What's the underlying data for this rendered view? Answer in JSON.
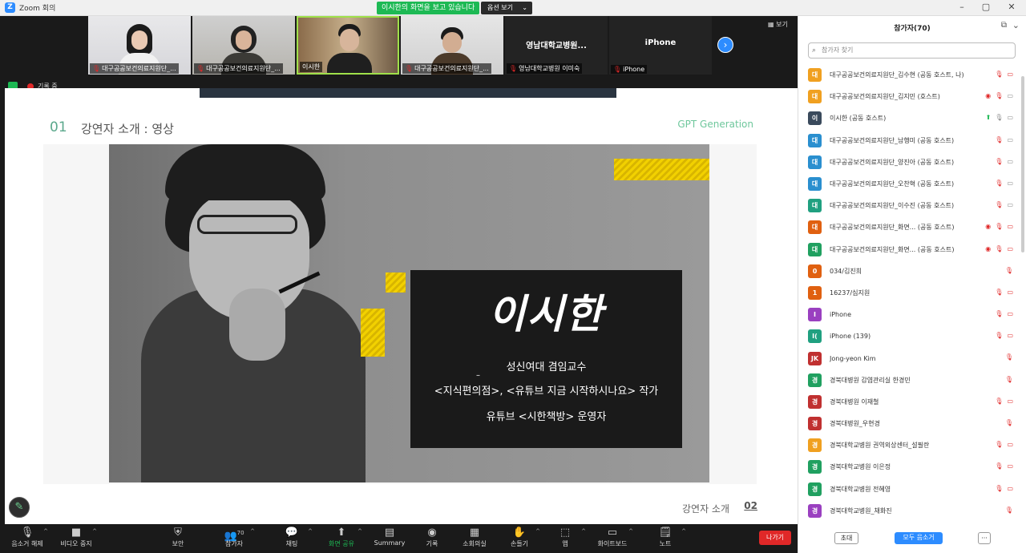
{
  "window": {
    "title": "Zoom 회의",
    "share_banner": "이시한의 화면을 보고 있습니다",
    "view_options": "옵션 보기"
  },
  "strip": {
    "tiles": [
      {
        "label": "대구공공보건의료지원단_..."
      },
      {
        "label": "대구공공보건의료지원단_..."
      },
      {
        "label": "이시한"
      },
      {
        "label": "대구공공보건의료지원단_..."
      },
      {
        "center": "영남대학교병원...",
        "label": "영남대학교병원 이미숙"
      },
      {
        "center": "iPhone",
        "label": "iPhone"
      }
    ],
    "view_label": "보기",
    "recording": "기록 중"
  },
  "slide": {
    "number": "01",
    "heading": "강연자 소개 : 영상",
    "brand": "GPT Generation",
    "speaker_name": "이시한",
    "line1": "성신여대 겸임교수",
    "dash": "–",
    "line2": "<지식편의점>, <유튜브 지금 시작하시나요> 작가",
    "line3": "유튜브 <시한책방> 운영자",
    "footer_text": "강연자 소개",
    "footer_num": "02"
  },
  "toolbar": {
    "items": [
      {
        "label": "음소거 해제",
        "icon": "mic-muted-icon"
      },
      {
        "label": "비디오 중지",
        "icon": "video-icon"
      },
      {
        "label": "보안",
        "icon": "shield-icon"
      },
      {
        "label": "참가자",
        "icon": "participants-icon",
        "count": "70"
      },
      {
        "label": "채팅",
        "icon": "chat-icon"
      },
      {
        "label": "화면 공유",
        "icon": "share-screen-icon"
      },
      {
        "label": "Summary",
        "icon": "summary-icon"
      },
      {
        "label": "기록",
        "icon": "record-icon"
      },
      {
        "label": "소회의실",
        "icon": "breakout-icon"
      },
      {
        "label": "손들기",
        "icon": "raise-hand-icon"
      },
      {
        "label": "앱",
        "icon": "apps-icon"
      },
      {
        "label": "화이트보드",
        "icon": "whiteboard-icon"
      },
      {
        "label": "노트",
        "icon": "notes-icon"
      }
    ],
    "leave": "나가기"
  },
  "panel": {
    "title": "참가자(70)",
    "search_placeholder": "참가자 찾기",
    "participants": [
      {
        "initial": "대",
        "name": "대구공공보건의료지원단_김수현 (공동 호스트, 나)",
        "color": "#f0a020"
      },
      {
        "initial": "대",
        "name": "대구공공보건의료지원단_김지민 (호스트)",
        "color": "#f0a020"
      },
      {
        "initial": "이",
        "name": "이시한 (공동 호스트)",
        "color": "#3a4a5c"
      },
      {
        "initial": "대",
        "name": "대구공공보건의료지원단_남행미 (공동 호스트)",
        "color": "#2a8fcf"
      },
      {
        "initial": "대",
        "name": "대구공공보건의료지원단_양진아 (공동 호스트)",
        "color": "#2a8fcf"
      },
      {
        "initial": "대",
        "name": "대구공공보건의료지원단_오찬혁 (공동 호스트)",
        "color": "#2a8fcf"
      },
      {
        "initial": "대",
        "name": "대구공공보건의료지원단_이수진 (공동 호스트)",
        "color": "#20a080"
      },
      {
        "initial": "대",
        "name": "대구공공보건의료지원단_화면...  (공동 호스트)",
        "color": "#e06010"
      },
      {
        "initial": "대",
        "name": "대구공공보건의료지원단_화면...  (공동 호스트)",
        "color": "#20a060"
      },
      {
        "initial": "0",
        "name": "034/김진희",
        "color": "#e06010"
      },
      {
        "initial": "1",
        "name": "16237/심지원",
        "color": "#e06010"
      },
      {
        "initial": "I",
        "name": "iPhone",
        "color": "#9a40c0"
      },
      {
        "initial": "I(",
        "name": "iPhone (139)",
        "color": "#20a080"
      },
      {
        "initial": "JK",
        "name": "Jong-yeon Kim",
        "color": "#c03030"
      },
      {
        "initial": "경",
        "name": "경북대병원 감염관리실 한경민",
        "color": "#20a060"
      },
      {
        "initial": "경",
        "name": "경북대병원 이재철",
        "color": "#c03030"
      },
      {
        "initial": "경",
        "name": "경북대병원_우현경",
        "color": "#c03030"
      },
      {
        "initial": "경",
        "name": "경북대학교병원 권역외상센터_설필란",
        "color": "#f0a020"
      },
      {
        "initial": "경",
        "name": "경북대학교병원 이은정",
        "color": "#20a060"
      },
      {
        "initial": "경",
        "name": "경북대학교병원 전혜영",
        "color": "#20a060"
      },
      {
        "initial": "경",
        "name": "경북대학교병원_채화진",
        "color": "#9a40c0"
      }
    ],
    "invite": "초대",
    "mute_all": "모두 음소거",
    "more": "···"
  }
}
